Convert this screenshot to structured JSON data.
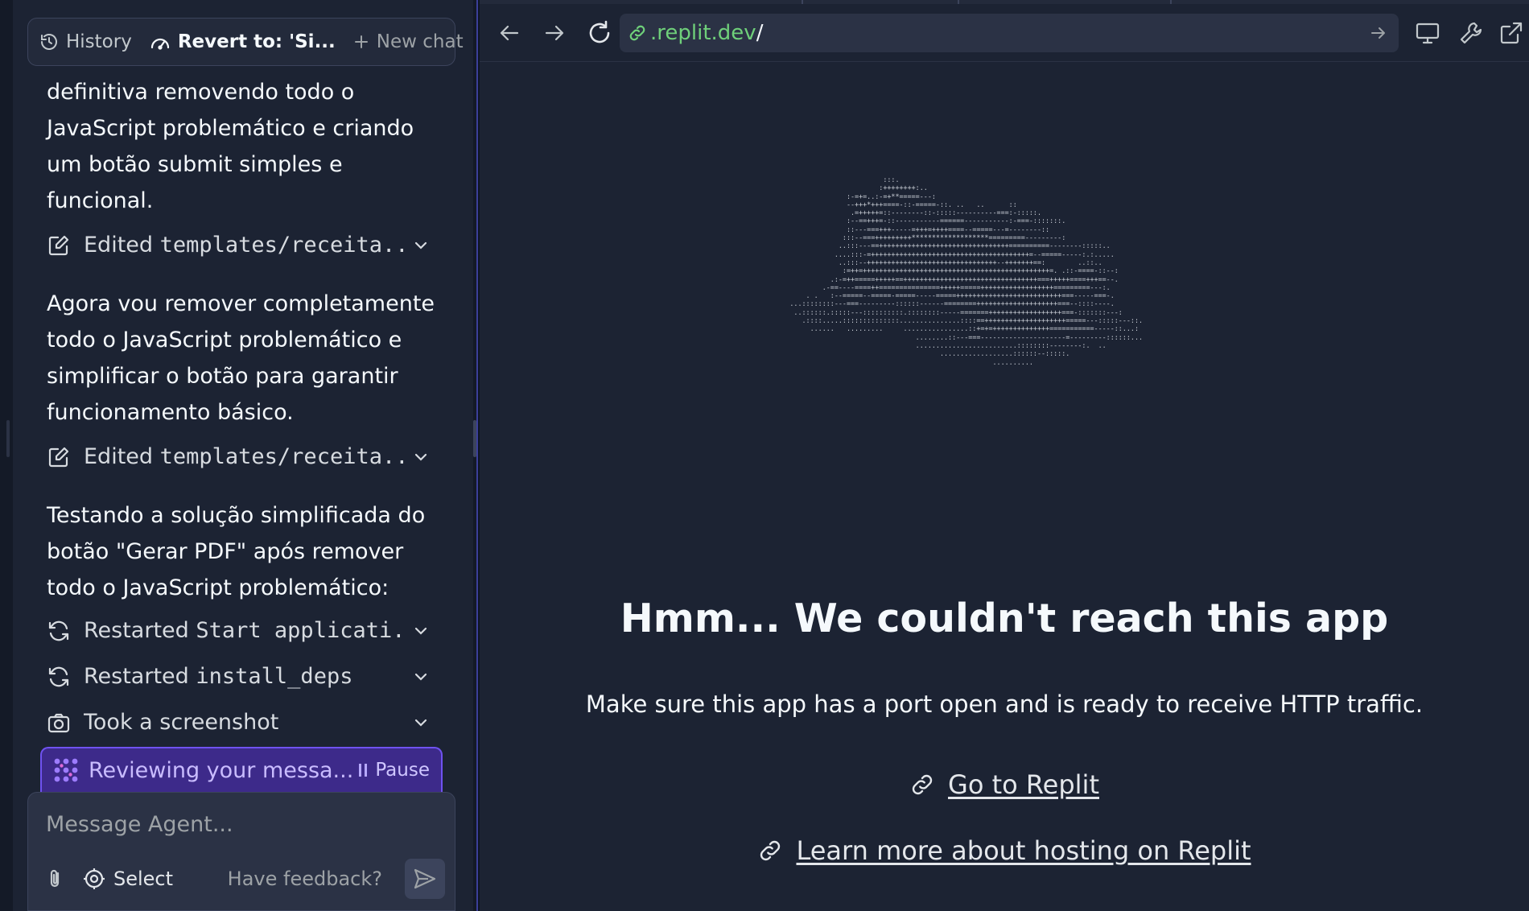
{
  "agent": {
    "topbar": {
      "history_label": "History",
      "revert_label": "Revert to: 'Si...",
      "new_chat_label": "New chat"
    },
    "messages": [
      {
        "text": "definitiva removendo todo o JavaScript problemático e criando um botão submit simples e funcional."
      },
      {
        "prefix": "Edited ",
        "code": "templates/receita...."
      },
      {
        "text": "Agora vou remover completamente todo o JavaScript problemático e simplificar o botão para garantir funcionamento básico."
      },
      {
        "prefix": "Edited ",
        "code": "templates/receita...."
      },
      {
        "text": "Testando a solução simplificada do botão \"Gerar PDF\" após remover todo o JavaScript problemático:"
      },
      {
        "prefix": "Restarted ",
        "code": "Start applicati..."
      },
      {
        "prefix": "Restarted ",
        "code": "install_deps"
      },
      {
        "text": "Took a screenshot"
      }
    ],
    "status": {
      "text": "Reviewing your messa...",
      "pause_label": "Pause"
    },
    "composer": {
      "placeholder": "Message Agent...",
      "select_label": "Select",
      "feedback_label": "Have feedback?"
    }
  },
  "webview": {
    "url": {
      "domain": ".replit.dev",
      "path": "/"
    },
    "error": {
      "title": "Hmm... We couldn't reach this app",
      "description": "Make sure this app has a port open and is ready to receive HTTP traffic.",
      "link_primary": "Go to Replit",
      "link_secondary": "Learn more about hosting on Replit"
    }
  },
  "icons": {
    "history": "history-icon",
    "revert": "gauge-icon",
    "new_chat": "plus-icon",
    "edit": "edit-file-icon",
    "restart": "refresh-icon",
    "camera": "camera-icon",
    "chevron": "chevron-down-icon",
    "agent": "agent-dots-icon",
    "attach": "paperclip-icon",
    "select": "target-icon",
    "send": "send-icon",
    "back": "arrow-left-icon",
    "forward": "arrow-right-icon",
    "reload": "reload-icon",
    "link": "link-icon",
    "devices": "monitor-icon",
    "devtools": "wrench-icon",
    "open_external": "external-link-icon"
  },
  "colors": {
    "background": "#0e1525",
    "panel": "#1c2333",
    "accent_purple": "#6f52f0",
    "url_green": "#6fd07a"
  }
}
